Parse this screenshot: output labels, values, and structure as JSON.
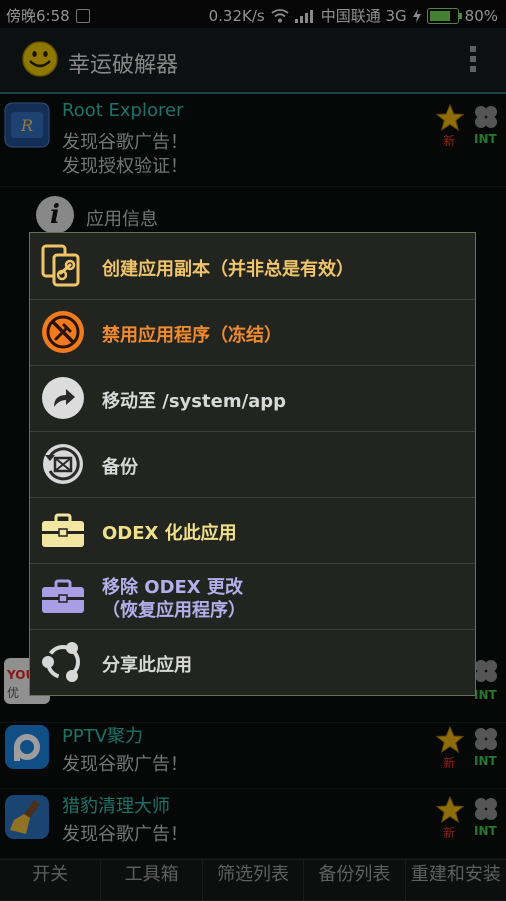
{
  "status_bar": {
    "time": "傍晚6:58",
    "speed": "0.32K/s",
    "carrier": "中国联通 3G",
    "battery": "80%",
    "battery_level": 0.8
  },
  "app_bar": {
    "title": "幸运破解器",
    "logo_icon": "smiley-icon",
    "menu_icon": "overflow-menu-icon"
  },
  "app_list": {
    "items": [
      {
        "name": "Root Explorer",
        "desc1": "发现谷歌广告！",
        "desc2": "发现授权验证！",
        "badge_new": "新",
        "badge_int": "INT",
        "icon": "root-explorer-icon"
      },
      {
        "name": "PPTV聚力",
        "desc1": "发现谷歌广告！",
        "badge_new": "新",
        "badge_int": "INT",
        "icon": "pptv-icon"
      },
      {
        "name": "猎豹清理大师",
        "desc1": "发现谷歌广告！",
        "badge_new": "新",
        "badge_int": "INT",
        "icon": "broom-icon"
      }
    ],
    "partial": {
      "icon_text": "YOU",
      "icon_text2": "优",
      "badge_int": "INT"
    }
  },
  "info_row": {
    "label": "应用信息",
    "icon_text": "i"
  },
  "context_menu": {
    "items": [
      {
        "label": "创建应用副本（并非总是有效）",
        "color": "#f0c46a",
        "icon": "copy-link-icon"
      },
      {
        "label": "禁用应用程序（冻结）",
        "color": "#f08a2e",
        "icon": "disable-icon"
      },
      {
        "label": "移动至 /system/app",
        "color": "#d8d8d8",
        "icon": "move-arrow-icon"
      },
      {
        "label": "备份",
        "color": "#d8d8d8",
        "icon": "backup-icon"
      },
      {
        "label": "ODEX 化此应用",
        "color": "#f0e08a",
        "icon": "toolbox-icon"
      },
      {
        "label": "移除 ODEX 更改",
        "label2": "（恢复应用程序）",
        "color": "#b5aeea",
        "icon": "toolbox-purple-icon"
      },
      {
        "label": "分享此应用",
        "color": "#d8d8d8",
        "icon": "share-icon"
      }
    ]
  },
  "bottom_tabs": [
    "开关",
    "工具箱",
    "筛选列表",
    "备份列表",
    "重建和安装"
  ]
}
